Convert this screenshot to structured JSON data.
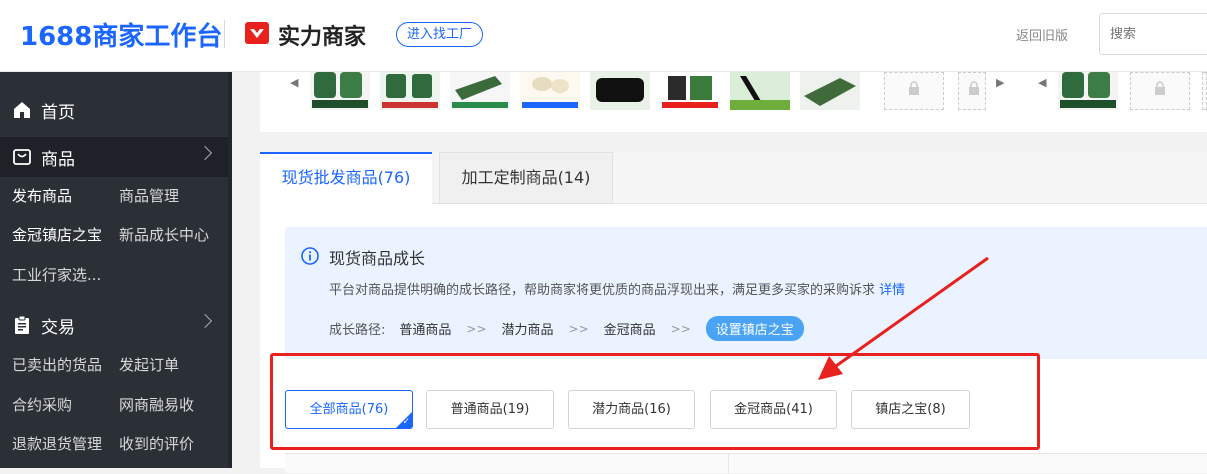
{
  "header": {
    "logo_text": "1688商家工作台",
    "brand_text": "实力商家",
    "factory_button": "进入找工厂",
    "old_version_link": "返回旧版",
    "search_placeholder": "搜索"
  },
  "sidebar": {
    "home": "首页",
    "product": "商品",
    "product_subs": [
      "发布商品",
      "商品管理",
      "金冠镇店之宝",
      "新品成长中心",
      "工业行家选..."
    ],
    "trade": "交易",
    "trade_subs": [
      "已卖出的货品",
      "发起订单",
      "合约采购",
      "网商融易收",
      "退款退货管理",
      "收到的评价"
    ]
  },
  "tabs": [
    {
      "label": "现货批发商品(76)",
      "active": true
    },
    {
      "label": "加工定制商品(14)",
      "active": false
    }
  ],
  "growth": {
    "title": "现货商品成长",
    "desc": "平台对商品提供明确的成长路径，帮助商家将更优质的商品浮现出来，满足更多买家的采购诉求",
    "detail_link": "详情",
    "path_label": "成长路径:",
    "steps": [
      "普通商品",
      "潜力商品",
      "金冠商品"
    ],
    "action": "设置镇店之宝"
  },
  "filters": [
    {
      "label": "全部商品(76)",
      "active": true
    },
    {
      "label": "普通商品(19)",
      "active": false
    },
    {
      "label": "潜力商品(16)",
      "active": false
    },
    {
      "label": "金冠商品(41)",
      "active": false
    },
    {
      "label": "镇店之宝(8)",
      "active": false
    }
  ],
  "colors": {
    "accent": "#1a66ff",
    "sidebar_bg": "#2b2f36",
    "highlight_red": "#e8211f",
    "growth_bg": "#eaf3ff"
  }
}
